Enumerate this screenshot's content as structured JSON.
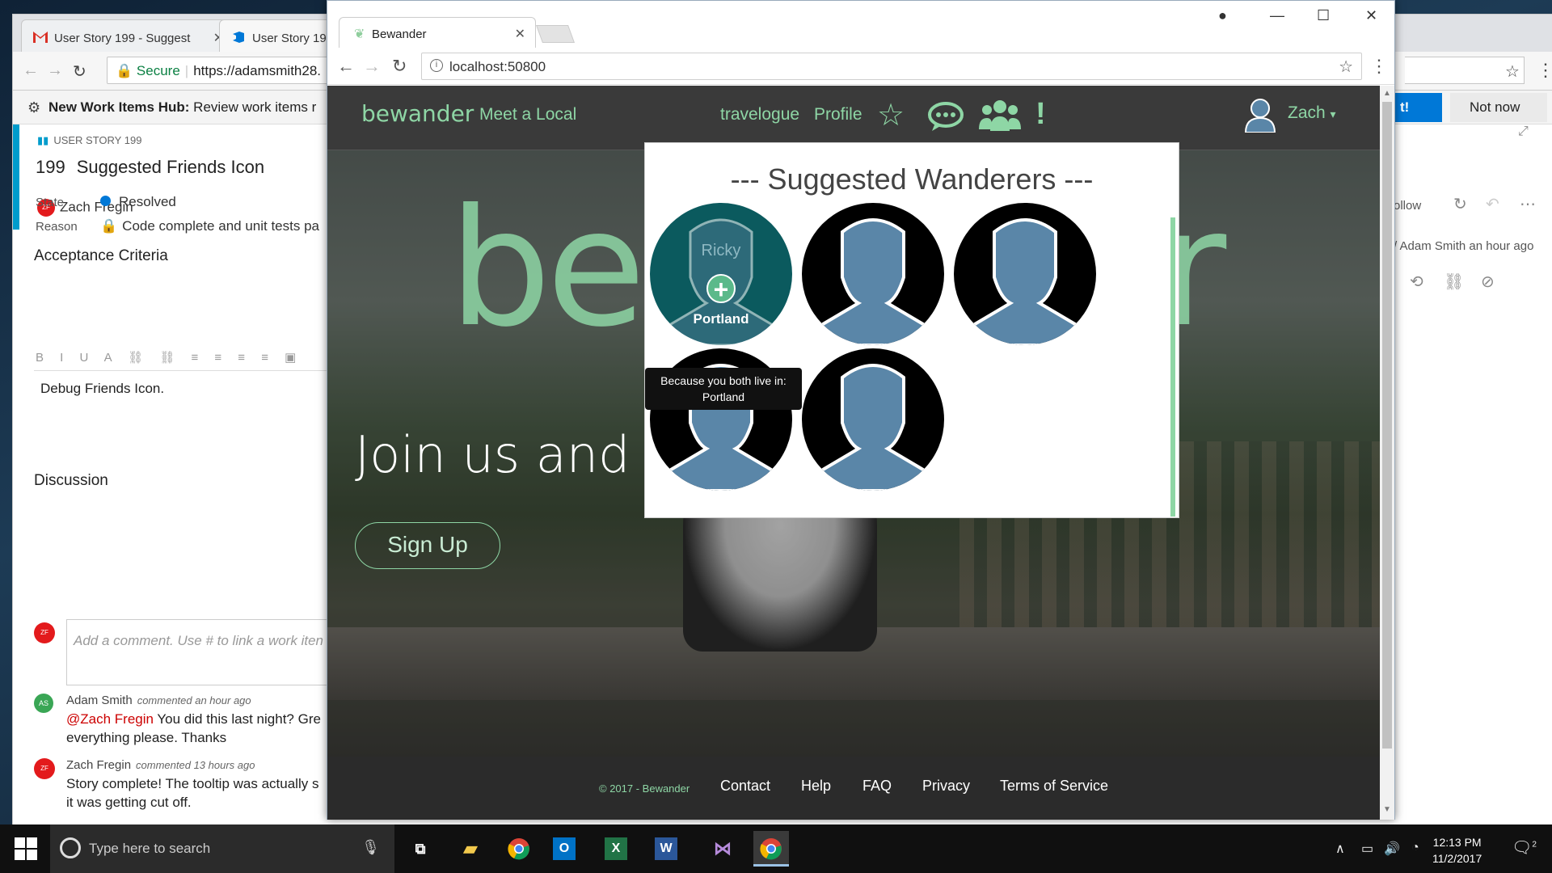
{
  "background_window": {
    "tabs": [
      {
        "label": "User Story 199 - Suggest",
        "close": "✕"
      },
      {
        "label": "User Story 19",
        "close": ""
      }
    ],
    "address": {
      "secure_label": "Secure",
      "url": "https://adamsmith28."
    },
    "banner": {
      "title": "New Work Items Hub:",
      "text": "Review work items r",
      "got_it": "t!",
      "not_now": "Not now"
    },
    "work_item": {
      "type": "USER STORY 199",
      "id": "199",
      "title": "Suggested Friends Icon",
      "assigned_to": "Zach Fregin",
      "state_label": "State",
      "state_value": "Resolved",
      "reason_label": "Reason",
      "reason_value": "Code complete and unit tests pa",
      "acceptance_title": "Acceptance Criteria",
      "acceptance_text": "Debug Friends Icon.",
      "discussion_title": "Discussion",
      "comment_placeholder": "Add a comment. Use # to link a work iten",
      "comments": [
        {
          "initials": "AS",
          "author": "Adam Smith",
          "when": "commented an hour ago",
          "mention": "@Zach Fregin",
          "text": " You did this last night? Gre",
          "text2": "everything please. Thanks"
        },
        {
          "initials": "ZF",
          "author": "Zach Fregin",
          "when": "commented 13 hours ago",
          "text": "Story complete! The tooltip was actually s",
          "text2": "it was getting cut off."
        }
      ],
      "avatar_initials": "ZF"
    },
    "right_panel": {
      "follow": "ollow",
      "history": "/ Adam Smith an hour ago"
    }
  },
  "foreground_window": {
    "tab_title": "Bewander",
    "url": "localhost:50800",
    "site": {
      "brand": "bewander",
      "meet": "Meet a Local",
      "nav": [
        "travelogue",
        "Profile"
      ],
      "user": "Zach",
      "hero_left": "be",
      "hero_right": "r",
      "join": "Join us and",
      "signup": "Sign Up",
      "footer": {
        "copy": "© 2017 - Bewander",
        "links": [
          "Contact",
          "Help",
          "FAQ",
          "Privacy",
          "Terms of Service"
        ]
      }
    },
    "modal": {
      "title": "--- Suggested Wanderers ---",
      "hovered": {
        "name": "Ricky",
        "city": "Portland"
      },
      "tooltip_line1": "Because you both live in:",
      "tooltip_line2": "Portland"
    }
  },
  "taskbar": {
    "search_placeholder": "Type here to search",
    "time": "12:13 PM",
    "date": "11/2/2017",
    "notifications": "2"
  }
}
